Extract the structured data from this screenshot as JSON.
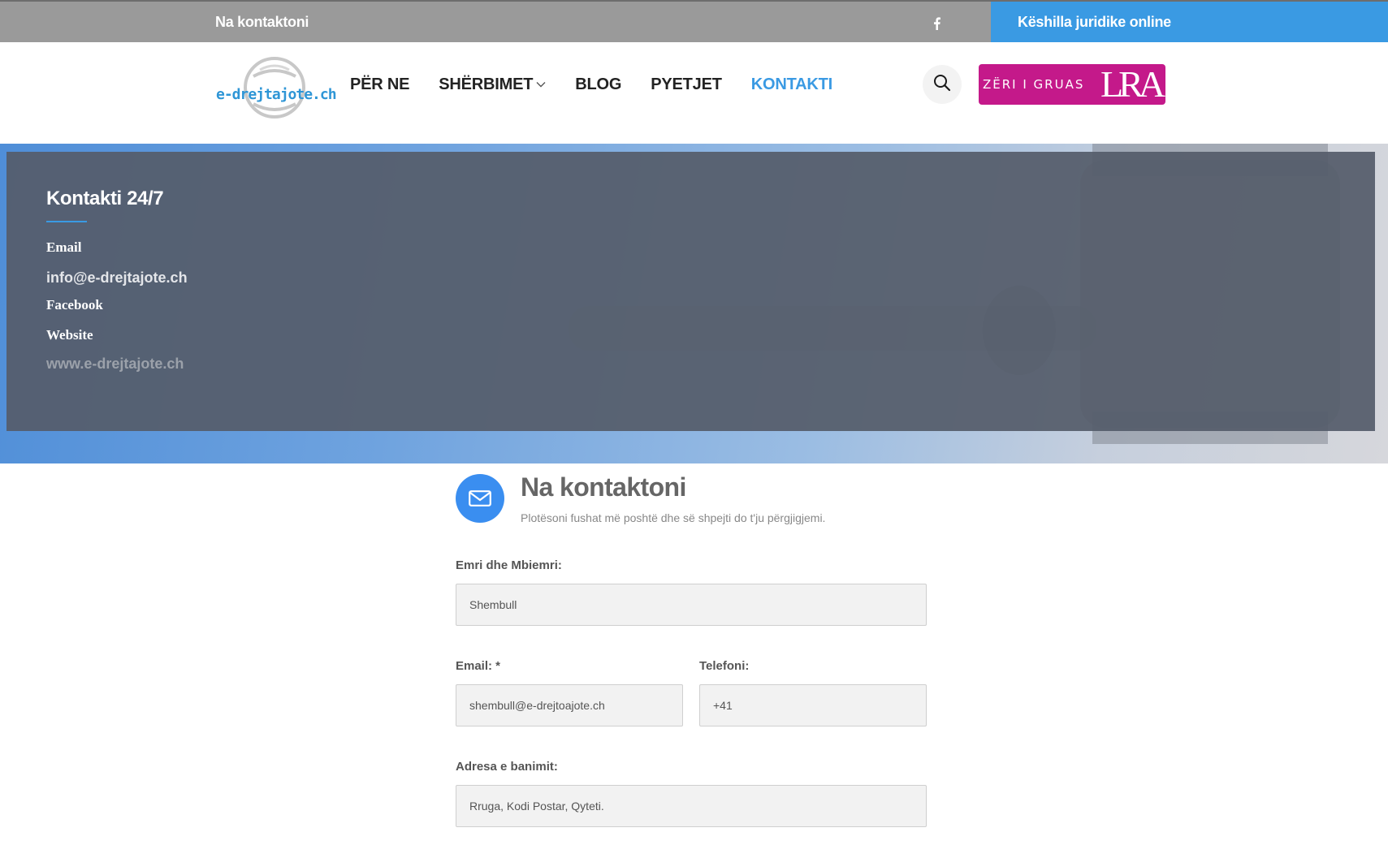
{
  "topbar": {
    "contact_text": "Na kontaktoni",
    "facebook_icon": "facebook-icon",
    "cta_label": "Këshilla juridike online"
  },
  "header": {
    "logo_text": "e-drejtajote.ch",
    "nav": [
      {
        "label": "PËR NE"
      },
      {
        "label": "SHËRBIMET"
      },
      {
        "label": "BLOG"
      },
      {
        "label": "PYETJET"
      },
      {
        "label": "KONTAKTI"
      }
    ],
    "active_nav": "KONTAKTI",
    "search_icon": "search-icon",
    "banner": {
      "text": "ZËRI I GRUAS",
      "mark": "LRA"
    }
  },
  "hero": {
    "title": "Kontakti 24/7",
    "email_label": "Email",
    "email_value": "info@e-drejtajote.ch",
    "facebook_label": "Facebook",
    "website_label": "Website",
    "website_value": "www.e-drejtajote.ch"
  },
  "form": {
    "icon": "envelope-icon",
    "title": "Na kontaktoni",
    "subtitle": "Plotësoni fushat më poshtë dhe së shpejti do t'ju përgjigjemi.",
    "name_label": "Emri dhe Mbiemri:",
    "name_placeholder": "Shembull",
    "email_label": "Email: *",
    "email_placeholder": "shembull@e-drejtoajote.ch",
    "phone_label": "Telefoni:",
    "phone_placeholder": "+41",
    "address_label": "Adresa e banimit:",
    "address_placeholder": "Rruga, Kodi Postar, Qyteti."
  },
  "colors": {
    "accent": "#3a9ae3",
    "topbar": "#9a9a9a",
    "banner": "#c4198a",
    "hero_panel": "#555d6b"
  }
}
